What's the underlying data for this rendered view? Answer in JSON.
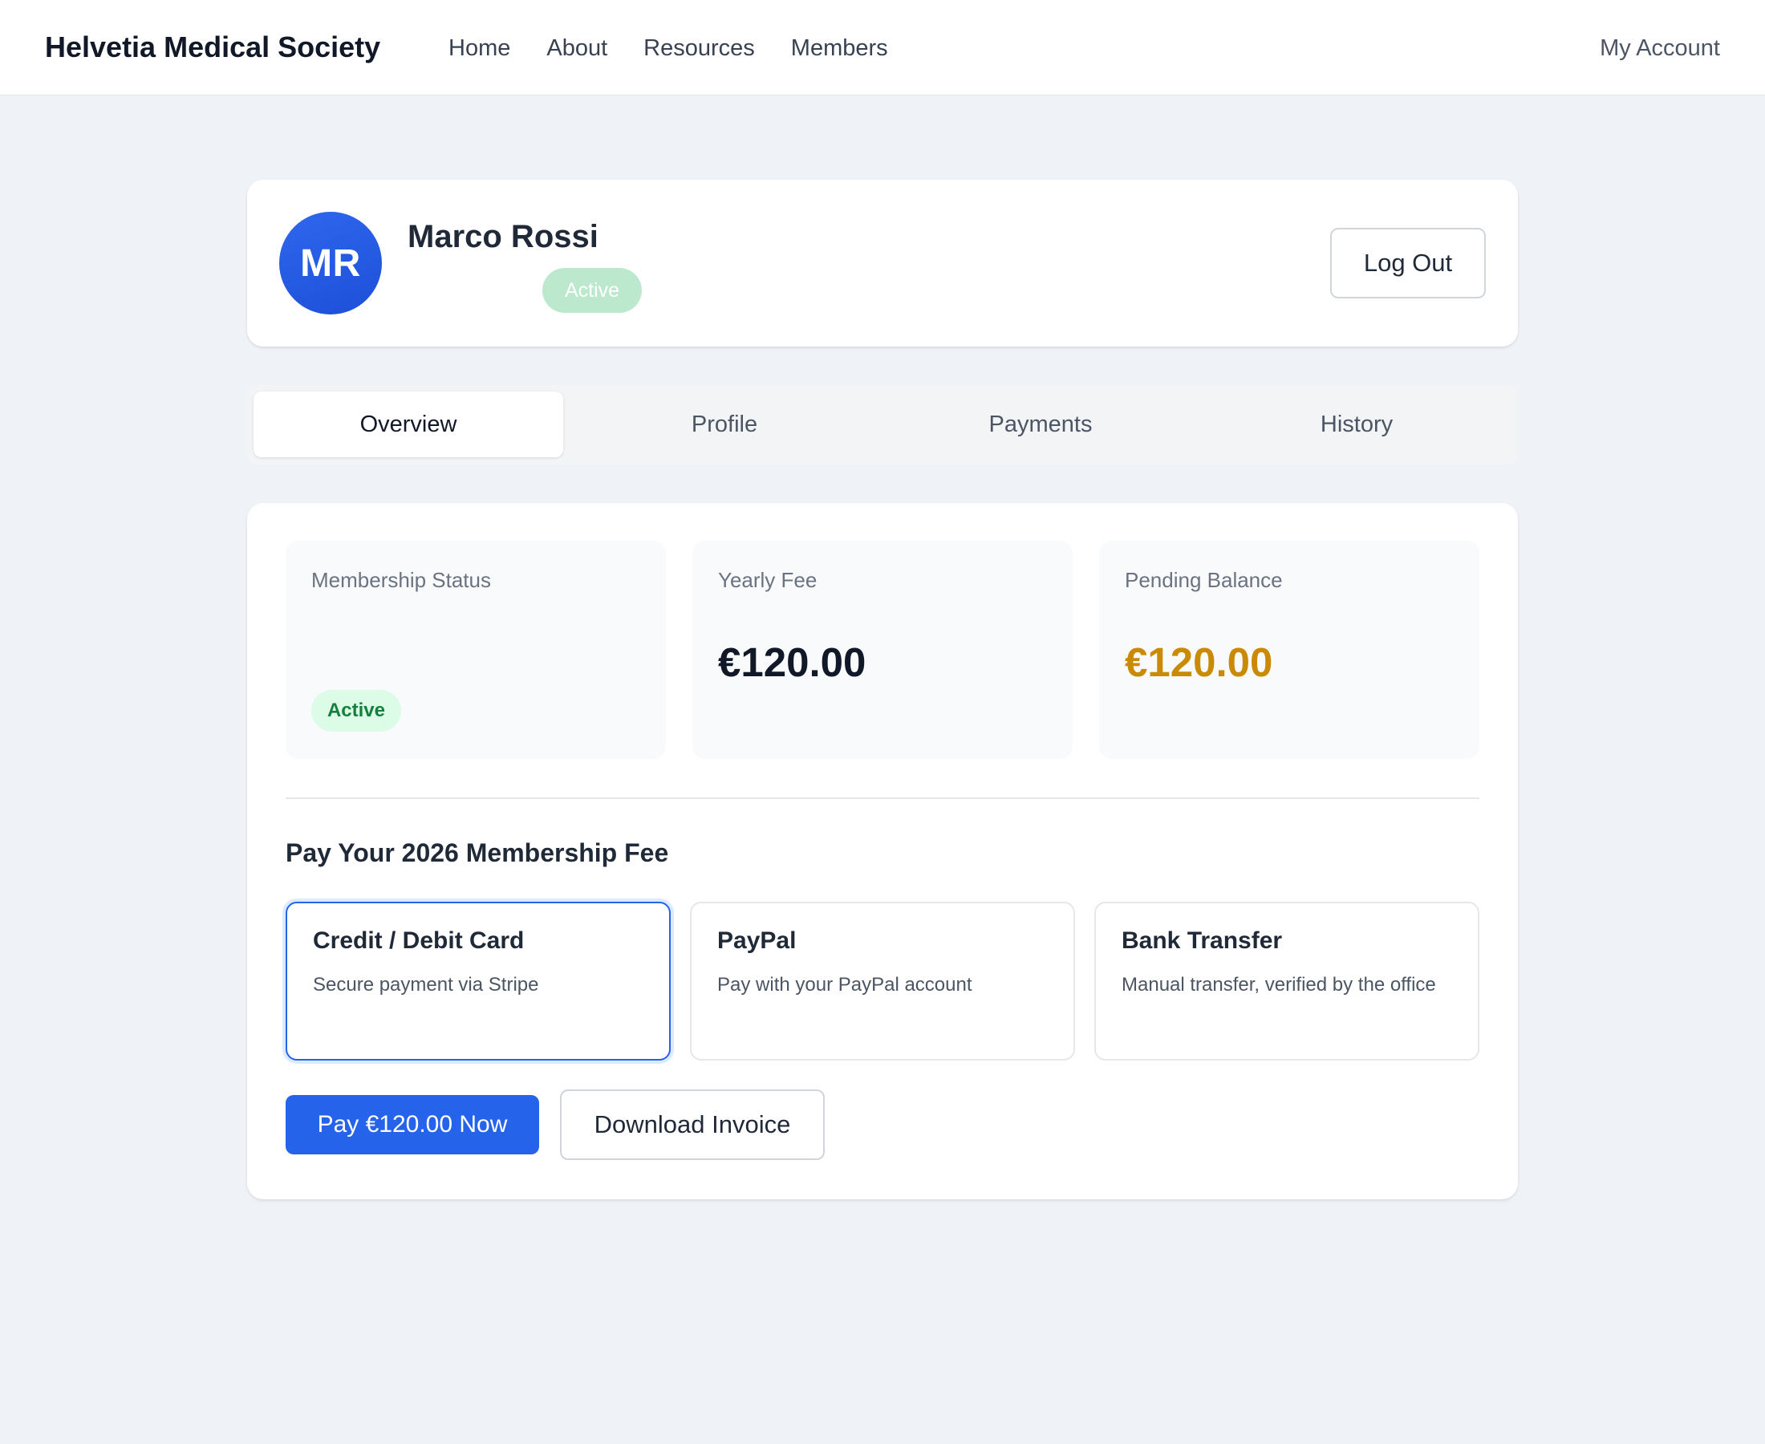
{
  "header": {
    "brand": "Helvetia Medical Society",
    "nav": [
      "Home",
      "About",
      "Resources",
      "Members"
    ],
    "account": "My Account"
  },
  "profile": {
    "initials": "MR",
    "name": "Marco Rossi",
    "badge": "Active",
    "logout_label": "Log Out"
  },
  "tabs": [
    {
      "label": "Overview",
      "active": true
    },
    {
      "label": "Profile",
      "active": false
    },
    {
      "label": "Payments",
      "active": false
    },
    {
      "label": "History",
      "active": false
    }
  ],
  "overview": {
    "membership_status": {
      "label": "Membership Status",
      "value": "Active"
    },
    "yearly_fee": {
      "label": "Yearly Fee",
      "value": "€120.00"
    },
    "pending_balance": {
      "label": "Pending Balance",
      "value": "€120.00"
    }
  },
  "payment": {
    "title": "Pay Your 2026 Membership Fee",
    "methods": [
      {
        "title": "Credit / Debit Card",
        "description": "Secure payment via Stripe",
        "selected": true
      },
      {
        "title": "PayPal",
        "description": "Pay with your PayPal account",
        "selected": false
      },
      {
        "title": "Bank Transfer",
        "description": "Manual transfer, verified by the office",
        "selected": false
      }
    ],
    "pay_button": "Pay €120.00 Now",
    "invoice_button": "Download Invoice"
  },
  "colors": {
    "primary": "#2563eb",
    "pending": "#ca8a04",
    "success_text": "#15803d",
    "success_bg": "#dcfce7",
    "page_bg": "#eff2f6"
  }
}
